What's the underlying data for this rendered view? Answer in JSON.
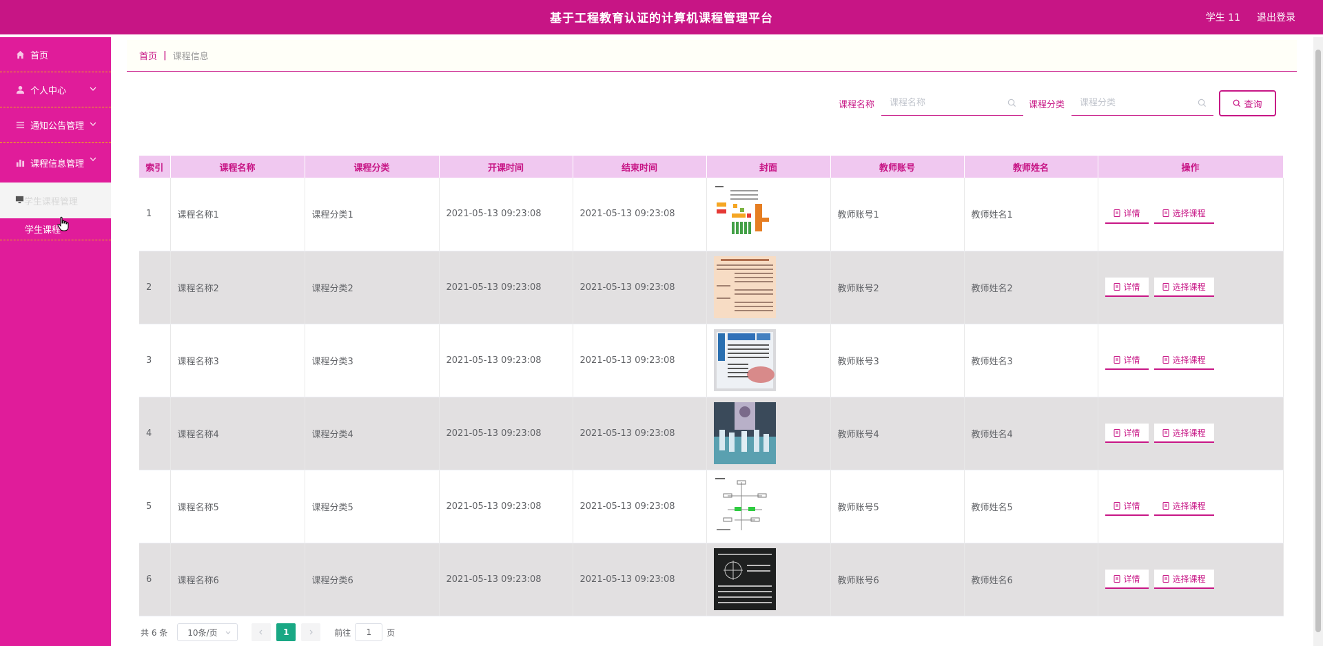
{
  "header": {
    "title": "基于工程教育认证的计算机课程管理平台",
    "user": "学生 11",
    "logout": "退出登录"
  },
  "sidebar": {
    "items": [
      {
        "label": "首页",
        "icon": "home-icon"
      },
      {
        "label": "个人中心",
        "icon": "user-icon"
      },
      {
        "label": "通知公告管理",
        "icon": "list-icon"
      },
      {
        "label": "课程信息管理",
        "icon": "chart-icon"
      }
    ],
    "active_group": "学生课程管理",
    "sub_item": "学生课程"
  },
  "breadcrumb": {
    "home": "首页",
    "separator": "|",
    "current": "课程信息"
  },
  "search": {
    "name_label": "课程名称",
    "name_placeholder": "课程名称",
    "category_label": "课程分类",
    "category_placeholder": "课程分类",
    "query_label": "查询"
  },
  "table": {
    "headers": [
      "索引",
      "课程名称",
      "课程分类",
      "开课时间",
      "结束时间",
      "封面",
      "教师账号",
      "教师姓名",
      "操作"
    ],
    "rows": [
      {
        "idx": "1",
        "name": "课程名称1",
        "category": "课程分类1",
        "start": "2021-05-13 09:23:08",
        "end": "2021-05-13 09:23:08",
        "cover": "flowchart",
        "account": "教师账号1",
        "teacher": "教师姓名1"
      },
      {
        "idx": "2",
        "name": "课程名称2",
        "category": "课程分类2",
        "start": "2021-05-13 09:23:08",
        "end": "2021-05-13 09:23:08",
        "cover": "document",
        "account": "教师账号2",
        "teacher": "教师姓名2"
      },
      {
        "idx": "3",
        "name": "课程名称3",
        "category": "课程分类3",
        "start": "2021-05-13 09:23:08",
        "end": "2021-05-13 09:23:08",
        "cover": "poster",
        "account": "教师账号3",
        "teacher": "教师姓名3"
      },
      {
        "idx": "4",
        "name": "课程名称4",
        "category": "课程分类4",
        "start": "2021-05-13 09:23:08",
        "end": "2021-05-13 09:23:08",
        "cover": "photo",
        "account": "教师账号4",
        "teacher": "教师姓名4"
      },
      {
        "idx": "5",
        "name": "课程名称5",
        "category": "课程分类5",
        "start": "2021-05-13 09:23:08",
        "end": "2021-05-13 09:23:08",
        "cover": "diagram",
        "account": "教师账号5",
        "teacher": "教师姓名5"
      },
      {
        "idx": "6",
        "name": "课程名称6",
        "category": "课程分类6",
        "start": "2021-05-13 09:23:08",
        "end": "2021-05-13 09:23:08",
        "cover": "blackboard",
        "account": "教师账号6",
        "teacher": "教师姓名6"
      }
    ],
    "detail_label": "详情",
    "select_label": "选择课程"
  },
  "pagination": {
    "total": "共 6 条",
    "page_size": "10条/页",
    "current_page": "1",
    "goto_label": "前往",
    "goto_value": "1",
    "page_suffix": "页"
  },
  "colors": {
    "brand": "#c71585",
    "sidebar": "#e01c9a",
    "header_row": "#f0c8f0",
    "page_active": "#19a884"
  }
}
